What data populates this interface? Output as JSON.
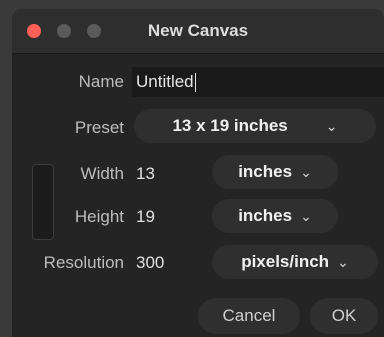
{
  "window": {
    "title": "New Canvas"
  },
  "form": {
    "name_label": "Name",
    "name_value": "Untitled",
    "preset_label": "Preset",
    "preset_value": "13 x 19 inches",
    "width_label": "Width",
    "width_value": "13",
    "width_unit": "inches",
    "height_label": "Height",
    "height_value": "19",
    "height_unit": "inches",
    "resolution_label": "Resolution",
    "resolution_value": "300",
    "resolution_unit": "pixels/inch"
  },
  "buttons": {
    "cancel": "Cancel",
    "ok": "OK"
  },
  "icons": {
    "dropdown": "chevron-down-icon",
    "link": "link-bracket-icon"
  },
  "colors": {
    "close": "#ff5f57",
    "background": "#242424",
    "pill": "#2f2f2f"
  }
}
